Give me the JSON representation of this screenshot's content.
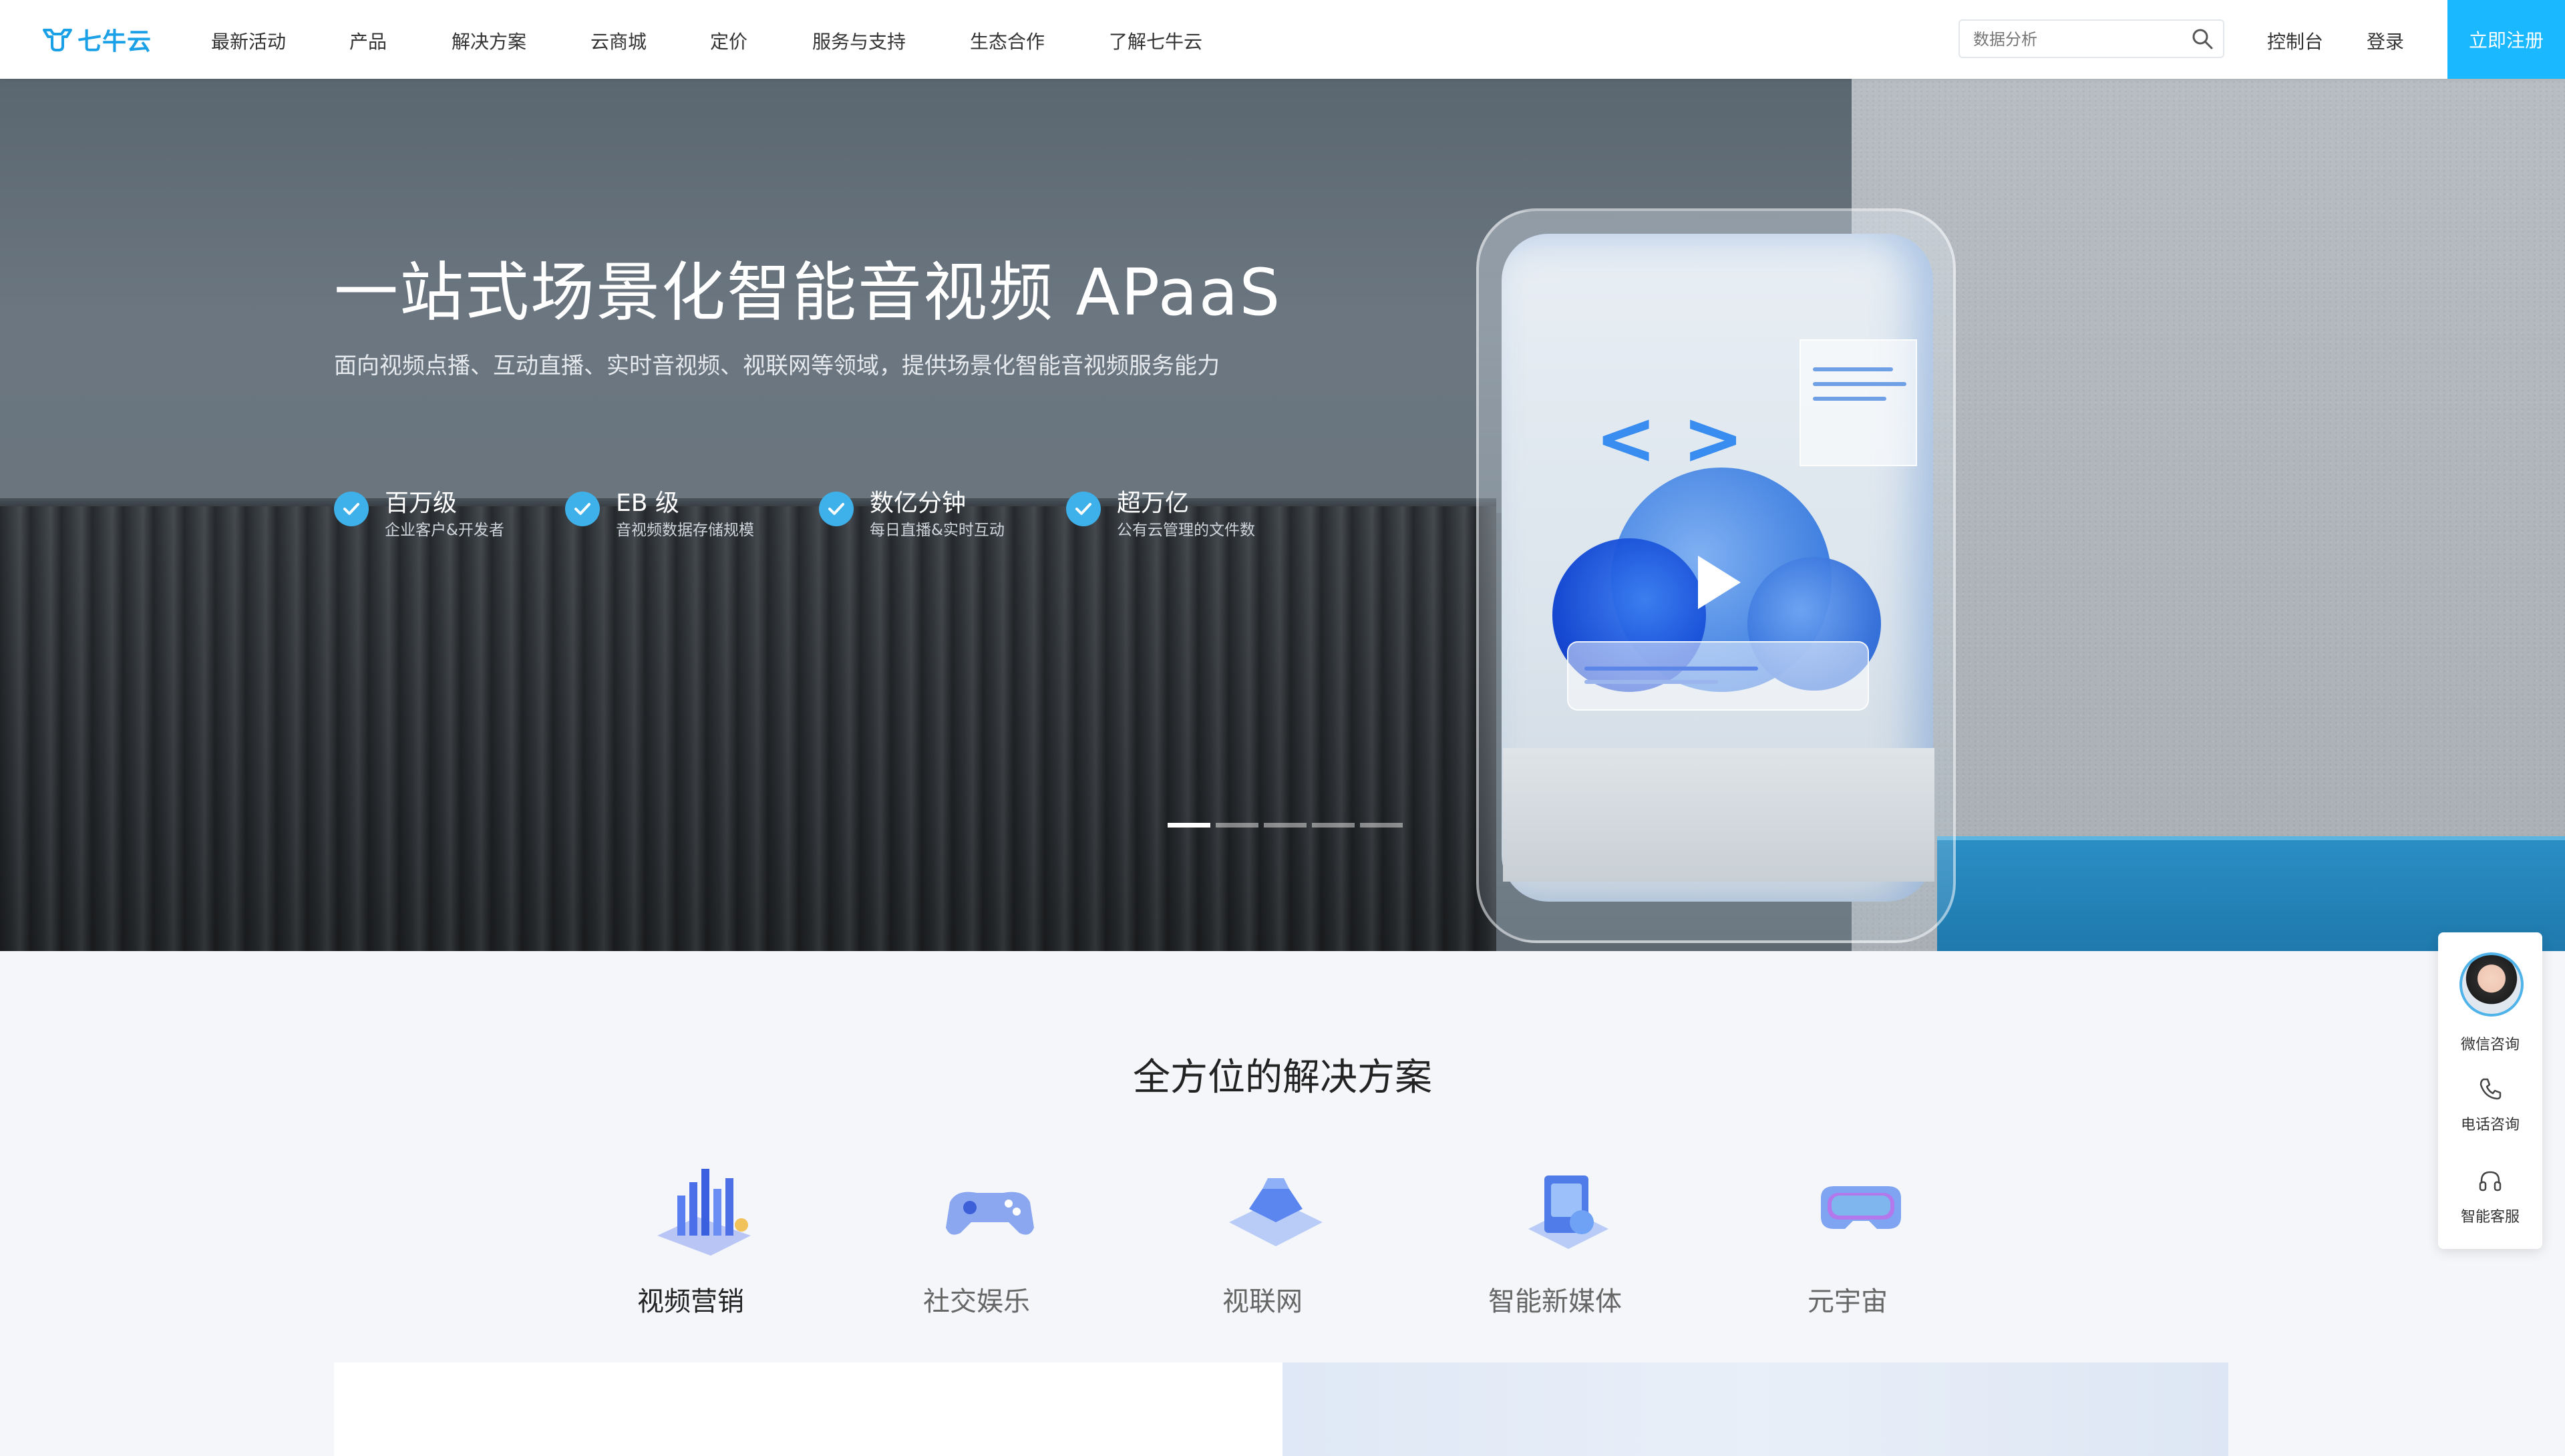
{
  "header": {
    "logo_text": "七牛云",
    "nav": [
      "最新活动",
      "产品",
      "解决方案",
      "云商城",
      "定价",
      "服务与支持",
      "生态合作",
      "了解七牛云"
    ],
    "search_placeholder": "数据分析",
    "console": "控制台",
    "login": "登录",
    "register": "立即注册"
  },
  "hero": {
    "title": "一站式场景化智能音视频 APaaS",
    "subtitle": "面向视频点播、互动直播、实时音视频、视联网等领域，提供场景化智能音视频服务能力",
    "features": [
      {
        "title": "百万级",
        "desc": "企业客户&开发者"
      },
      {
        "title": "EB 级",
        "desc": "音视频数据存储规模"
      },
      {
        "title": "数亿分钟",
        "desc": "每日直播&实时互动"
      },
      {
        "title": "超万亿",
        "desc": "公有云管理的文件数"
      }
    ],
    "slides_total": 5,
    "active_slide": 1,
    "code_glyph": "< >"
  },
  "solutions": {
    "title": "全方位的解决方案",
    "items": [
      "视频营销",
      "社交娱乐",
      "视联网",
      "智能新媒体",
      "元宇宙"
    ],
    "active_index": 0
  },
  "consult": {
    "wechat": "微信咨询",
    "phone": "电话咨询",
    "service": "智能客服"
  },
  "colors": {
    "brand": "#1aa0e6",
    "register_bg": "#1ab8ff",
    "check": "#3fb1ea"
  }
}
